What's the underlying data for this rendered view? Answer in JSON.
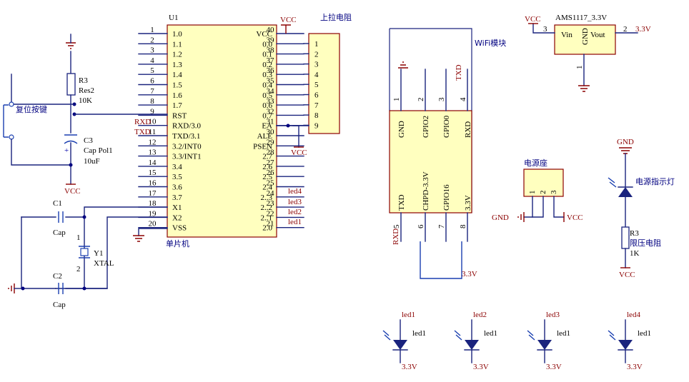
{
  "mcu": {
    "ref": "U1",
    "name": "单片机",
    "left_pins": [
      {
        "num": "1",
        "name": "1.0"
      },
      {
        "num": "2",
        "name": "1.1"
      },
      {
        "num": "3",
        "name": "1.2"
      },
      {
        "num": "4",
        "name": "1.3"
      },
      {
        "num": "5",
        "name": "1.4"
      },
      {
        "num": "6",
        "name": "1.5"
      },
      {
        "num": "7",
        "name": "1.6"
      },
      {
        "num": "8",
        "name": "1.7"
      },
      {
        "num": "9",
        "name": "RST"
      },
      {
        "num": "10",
        "name": "RXD/3.0"
      },
      {
        "num": "11",
        "name": "TXD/3.1"
      },
      {
        "num": "12",
        "name": "3.2/INT0"
      },
      {
        "num": "13",
        "name": "3.3/INT1"
      },
      {
        "num": "14",
        "name": "3.4"
      },
      {
        "num": "15",
        "name": "3.5"
      },
      {
        "num": "16",
        "name": "3.6"
      },
      {
        "num": "17",
        "name": "3.7"
      },
      {
        "num": "18",
        "name": "X1"
      },
      {
        "num": "19",
        "name": "X2"
      },
      {
        "num": "20",
        "name": "VSS"
      }
    ],
    "right_pins": [
      {
        "num": "40",
        "name": "VCC"
      },
      {
        "num": "39",
        "name": "0.0"
      },
      {
        "num": "38",
        "name": "0.1"
      },
      {
        "num": "37",
        "name": "0.2"
      },
      {
        "num": "36",
        "name": "0.3"
      },
      {
        "num": "35",
        "name": "0.4"
      },
      {
        "num": "34",
        "name": "0.5"
      },
      {
        "num": "33",
        "name": "0.6"
      },
      {
        "num": "32",
        "name": "0.7"
      },
      {
        "num": "31",
        "name": "EA"
      },
      {
        "num": "30",
        "name": "ALE"
      },
      {
        "num": "29",
        "name": "PSEN"
      },
      {
        "num": "28",
        "name": "2.7"
      },
      {
        "num": "27",
        "name": "2.6"
      },
      {
        "num": "26",
        "name": "2.5"
      },
      {
        "num": "25",
        "name": "2.4"
      },
      {
        "num": "24",
        "name": "2..3"
      },
      {
        "num": "23",
        "name": "2..2"
      },
      {
        "num": "22",
        "name": "2..1"
      },
      {
        "num": "21",
        "name": "2.0"
      }
    ],
    "net_labels_left": [
      "RXD",
      "TXD"
    ],
    "net_labels_right": [
      "led4",
      "led3",
      "led2",
      "led1"
    ]
  },
  "pullup": {
    "title": "上拉电阻",
    "pins": [
      "1",
      "2",
      "3",
      "4",
      "5",
      "6",
      "7",
      "8",
      "9"
    ]
  },
  "reset": {
    "button_label": "复位按键",
    "r_ref": "R3",
    "r_value": "Res2",
    "r_ohm": "10K",
    "c_ref": "C3",
    "c_value": "Cap Pol1",
    "c_farad": "10uF",
    "c_plus": "+",
    "vcc": "VCC"
  },
  "crystal": {
    "c1_ref": "C1",
    "c1_value": "Cap",
    "c2_ref": "C2",
    "c2_value": "Cap",
    "y_ref": "Y1",
    "y_value": "XTAL",
    "pin1": "1",
    "pin2": "2"
  },
  "power": {
    "vcc": "VCC",
    "gnd": "GND",
    "v33": "3.3V"
  },
  "wifi": {
    "title": "WiFi模块",
    "top_pins": [
      {
        "num": "1",
        "name": "GND"
      },
      {
        "num": "2",
        "name": "GPIO2"
      },
      {
        "num": "3",
        "name": "GPIO0"
      },
      {
        "num": "4",
        "name": "RXD"
      }
    ],
    "bottom_pins": [
      {
        "num": "5",
        "name": "TXD"
      },
      {
        "num": "6",
        "name": "CHPD-3.3V"
      },
      {
        "num": "7",
        "name": "GPIO16"
      },
      {
        "num": "8",
        "name": "3.3V"
      }
    ],
    "net_top": "TXD",
    "net_bottom": "RXD",
    "supply": "3.3V"
  },
  "regulator": {
    "name": "AMS1117_3.3V",
    "vin": "Vin",
    "vout": "Vout",
    "gnd": "GND",
    "pin_in": "3",
    "pin_out": "2",
    "pin_gnd": "1",
    "vcc": "VCC",
    "out": "3.3V"
  },
  "power_socket": {
    "title": "电源座",
    "pins": [
      "1",
      "2",
      "3"
    ],
    "gnd": "GND",
    "vcc": "VCC"
  },
  "power_led": {
    "gnd": "GND",
    "name": "电源指示灯",
    "r_ref": "R3",
    "r_name": "限压电阻",
    "r_value": "1K",
    "vcc": "VCC"
  },
  "leds": [
    {
      "net": "led1",
      "name": "led1",
      "supply": "3.3V"
    },
    {
      "net": "led2",
      "name": "led1",
      "supply": "3.3V"
    },
    {
      "net": "led3",
      "name": "led1",
      "supply": "3.3V"
    },
    {
      "net": "led4",
      "name": "led1",
      "supply": "3.3V"
    }
  ],
  "colors": {
    "wire": "#1a237e",
    "power": "#8b0000",
    "body_fill": "#ffffbf"
  }
}
